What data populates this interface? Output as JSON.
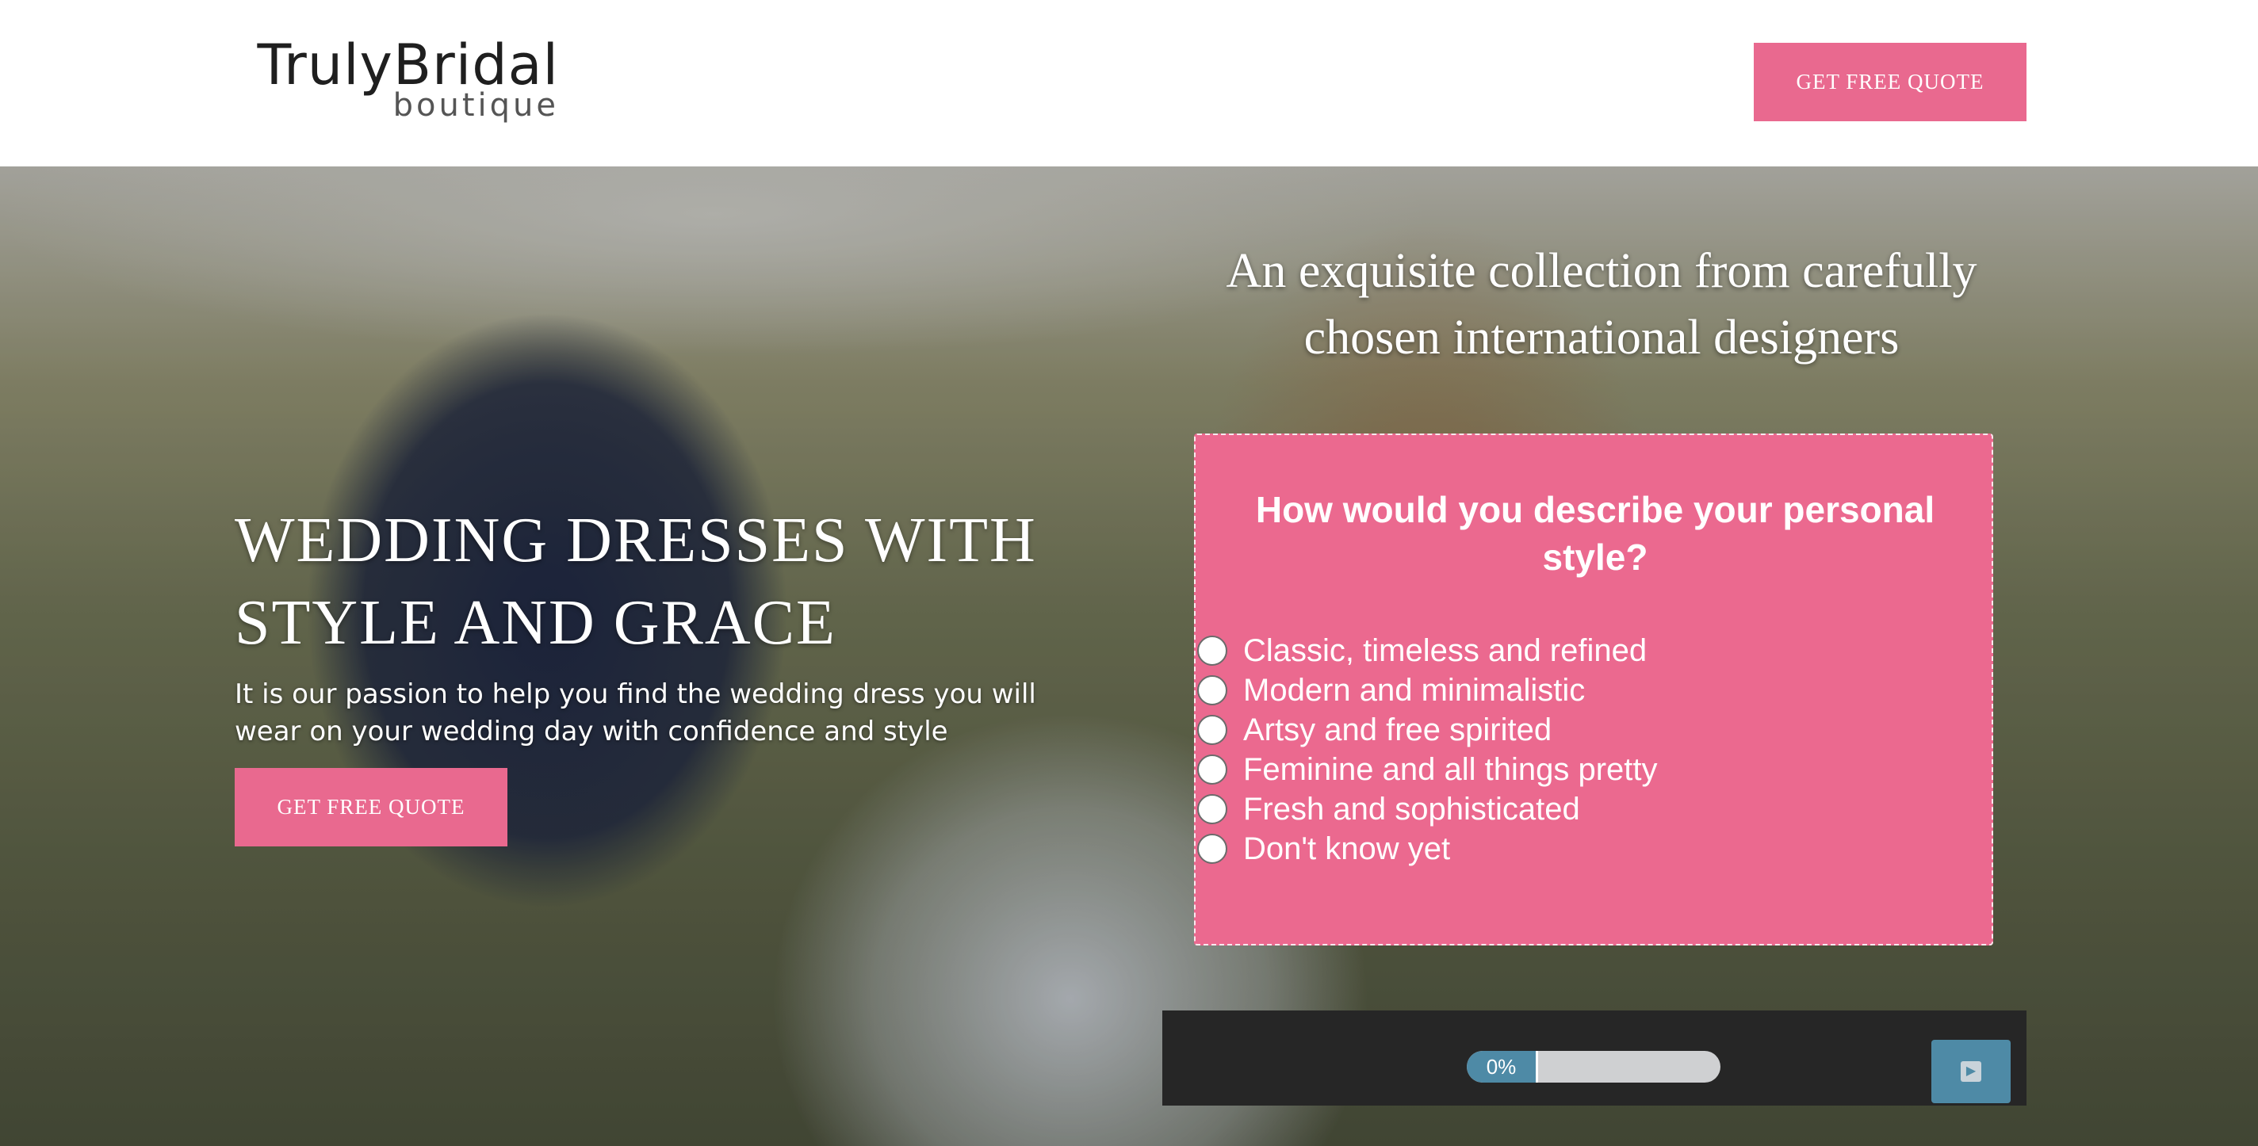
{
  "header": {
    "logo": {
      "main": "TrulyBridal",
      "sub": "boutique"
    },
    "cta_label": "GET FREE QUOTE"
  },
  "hero": {
    "tagline": "An exquisite collection from carefully chosen international designers",
    "title": "WEDDING DRESSES WITH STYLE AND GRACE",
    "subtitle": "It is our passion to help you find the wedding dress you will wear on your wedding day with confidence and style",
    "cta_label": "GET FREE QUOTE"
  },
  "quiz": {
    "question": "How would you describe your personal style?",
    "options": [
      "Classic, timeless and refined",
      "Modern and minimalistic",
      "Artsy and free spirited",
      "Feminine and all things pretty",
      "Fresh and sophisticated",
      "Don't know yet"
    ],
    "progress_label": "0%",
    "progress_value": 0
  },
  "colors": {
    "accent_pink": "#e9698f",
    "progress_blue": "#4e8aa6",
    "progress_bar_bg": "#262626"
  },
  "icons": {
    "next": "play-icon"
  }
}
